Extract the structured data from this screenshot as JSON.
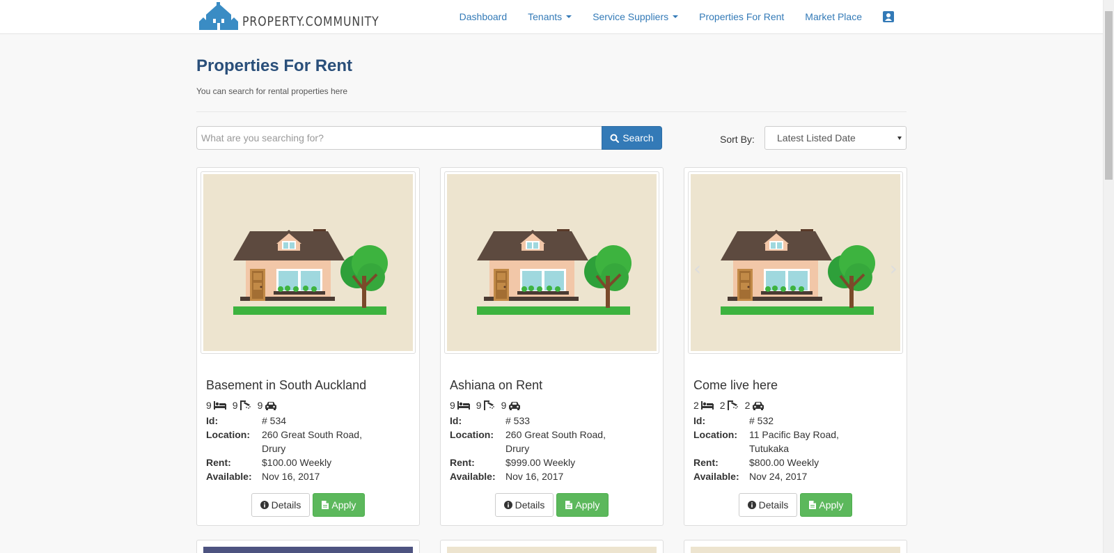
{
  "brand": {
    "name": "PROPERTY.COMMUNITY",
    "logo_icon": "houses-logo-icon",
    "color": "#3a8cc4"
  },
  "nav": {
    "dashboard": "Dashboard",
    "tenants": "Tenants",
    "service_suppliers": "Service Suppliers",
    "properties_for_rent": "Properties For Rent",
    "market_place": "Market Place",
    "profile_icon": "user-card-icon"
  },
  "page": {
    "title": "Properties For Rent",
    "subtitle": "You can search for rental properties here"
  },
  "search": {
    "placeholder": "What are you searching for?",
    "button_label": "Search"
  },
  "sort": {
    "label": "Sort By:",
    "selected": "Latest Listed Date"
  },
  "labels": {
    "id": "Id:",
    "location": "Location:",
    "rent": "Rent:",
    "available": "Available:",
    "details_button": "Details",
    "apply_button": "Apply"
  },
  "colors": {
    "primary": "#337ab7",
    "title": "#2a4f7a",
    "apply": "#5cb85c",
    "image_bg": "#ede4cf"
  },
  "properties": [
    {
      "title": "Basement in South Auckland",
      "bedrooms": "9",
      "bathrooms": "9",
      "parking": "9",
      "id": "# 534",
      "location_line1": "260 Great South Road,",
      "location_line2": "Drury",
      "rent": "$100.00 Weekly",
      "available": "Nov 16, 2017"
    },
    {
      "title": "Ashiana on Rent",
      "bedrooms": "9",
      "bathrooms": "9",
      "parking": "9",
      "id": "# 533",
      "location_line1": "260 Great South Road,",
      "location_line2": "Drury",
      "rent": "$999.00 Weekly",
      "available": "Nov 16, 2017"
    },
    {
      "title": "Come live here",
      "bedrooms": "2",
      "bathrooms": "2",
      "parking": "2",
      "id": "# 532",
      "location_line1": "11 Pacific Bay Road,",
      "location_line2": "Tutukaka",
      "rent": "$800.00 Weekly",
      "available": "Nov 24, 2017"
    }
  ]
}
